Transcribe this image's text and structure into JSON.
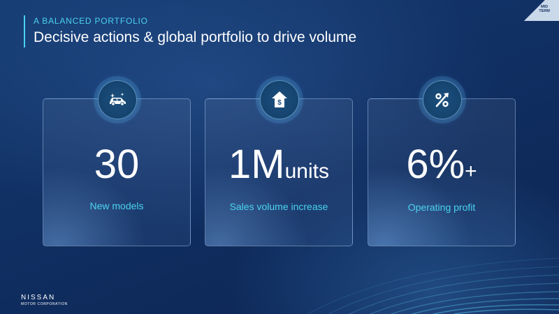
{
  "header": {
    "eyebrow": "A BALANCED PORTFOLIO",
    "title": "Decisive actions & global portfolio to drive volume",
    "corner_label": "MID TERM"
  },
  "cards": [
    {
      "icon": "car-sparkle-icon",
      "value": "30",
      "suffix": "",
      "label": "New models"
    },
    {
      "icon": "house-dollar-up-icon",
      "value": "1M",
      "suffix": "units",
      "label": "Sales volume increase"
    },
    {
      "icon": "percent-arrow-icon",
      "value": "6%",
      "suffix": "+",
      "label": "Operating profit"
    }
  ],
  "footer": {
    "brand": "NISSAN",
    "brand_sub": "MOTOR CORPORATION"
  },
  "colors": {
    "accent": "#4ad3f0",
    "background": "#102f62"
  }
}
